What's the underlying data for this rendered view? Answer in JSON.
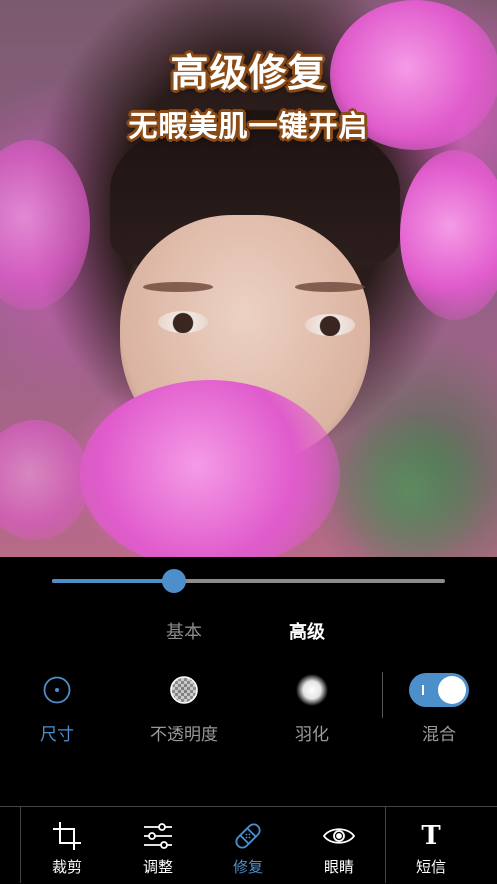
{
  "promo": {
    "headline": "高级修复",
    "subheadline": "无暇美肌一键开启"
  },
  "slider": {
    "value": 0.31
  },
  "mode_tabs": [
    {
      "label": "基本",
      "selected": false
    },
    {
      "label": "高级",
      "selected": true
    }
  ],
  "tools": [
    {
      "label": "尺寸",
      "icon": "size-circle-icon",
      "active": true
    },
    {
      "label": "不透明度",
      "icon": "opacity-checker-icon",
      "active": false
    },
    {
      "label": "羽化",
      "icon": "feather-blur-icon",
      "active": false
    },
    {
      "label": "混合",
      "icon": "blend-toggle",
      "active": true
    }
  ],
  "bottom_nav": [
    {
      "label": "裁剪",
      "icon": "crop-icon",
      "active": false
    },
    {
      "label": "调整",
      "icon": "sliders-icon",
      "active": false
    },
    {
      "label": "修复",
      "icon": "bandage-icon",
      "active": true
    },
    {
      "label": "眼睛",
      "icon": "eye-icon",
      "active": false
    },
    {
      "label": "短信",
      "icon": "text-icon",
      "active": false
    }
  ],
  "colors": {
    "accent": "#4d8fcb",
    "background": "#000000",
    "inactive_text": "#9a9a9a",
    "headline_outline": "#8a4b16"
  }
}
